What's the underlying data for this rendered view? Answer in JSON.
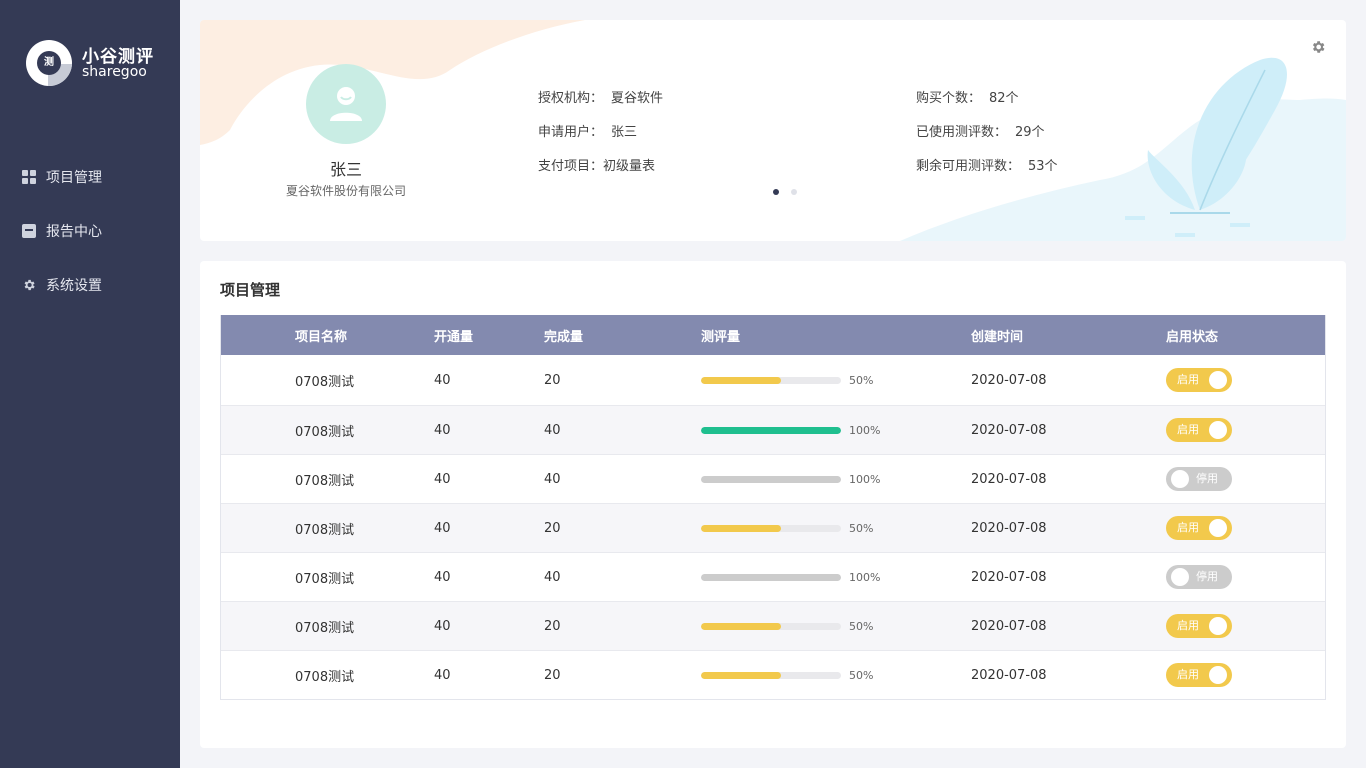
{
  "brand": {
    "name_cn": "小谷测评",
    "name_en": "sharegoo",
    "mark": "测"
  },
  "sidebar": {
    "items": [
      {
        "label": "项目管理",
        "icon": "grid-icon"
      },
      {
        "label": "报告中心",
        "icon": "box-icon"
      },
      {
        "label": "系统设置",
        "icon": "gear-icon"
      }
    ]
  },
  "profile": {
    "name": "张三",
    "company": "夏谷软件股份有限公司",
    "info_left": [
      {
        "label": "授权机构：",
        "value": "夏谷软件"
      },
      {
        "label": "申请用户：",
        "value": "张三"
      },
      {
        "label": "支付项目：",
        "value": "初级量表"
      }
    ],
    "info_right": [
      {
        "label": "购买个数：",
        "value": "82个"
      },
      {
        "label": "已使用测评数：",
        "value": "29个"
      },
      {
        "label": "剩余可用测评数：",
        "value": "53个"
      }
    ],
    "carousel": {
      "count": 2,
      "active": 0
    }
  },
  "colors": {
    "sidebar": "#343a55",
    "header": "#838aaf",
    "progress_yellow": "#f2c94c",
    "progress_green": "#1fbf8f",
    "progress_gray": "#cccccc",
    "toggle_on": "#f2c94c",
    "toggle_off": "#cccccc"
  },
  "project": {
    "title": "项目管理",
    "columns": [
      "项目名称",
      "开通量",
      "完成量",
      "测评量",
      "创建时间",
      "启用状态"
    ],
    "rows": [
      {
        "name": "0708测试",
        "opened": "40",
        "done": "20",
        "progress": 50,
        "pct": "50%",
        "color": "yellow",
        "date": "2020-07-08",
        "enabled": true,
        "status": "启用"
      },
      {
        "name": "0708测试",
        "opened": "40",
        "done": "40",
        "progress": 100,
        "pct": "100%",
        "color": "green",
        "date": "2020-07-08",
        "enabled": true,
        "status": "启用"
      },
      {
        "name": "0708测试",
        "opened": "40",
        "done": "40",
        "progress": 100,
        "pct": "100%",
        "color": "gray",
        "date": "2020-07-08",
        "enabled": false,
        "status": "停用"
      },
      {
        "name": "0708测试",
        "opened": "40",
        "done": "20",
        "progress": 50,
        "pct": "50%",
        "color": "yellow",
        "date": "2020-07-08",
        "enabled": true,
        "status": "启用"
      },
      {
        "name": "0708测试",
        "opened": "40",
        "done": "40",
        "progress": 100,
        "pct": "100%",
        "color": "gray",
        "date": "2020-07-08",
        "enabled": false,
        "status": "停用"
      },
      {
        "name": "0708测试",
        "opened": "40",
        "done": "20",
        "progress": 50,
        "pct": "50%",
        "color": "yellow",
        "date": "2020-07-08",
        "enabled": true,
        "status": "启用"
      },
      {
        "name": "0708测试",
        "opened": "40",
        "done": "20",
        "progress": 50,
        "pct": "50%",
        "color": "yellow",
        "date": "2020-07-08",
        "enabled": true,
        "status": "启用"
      }
    ]
  }
}
